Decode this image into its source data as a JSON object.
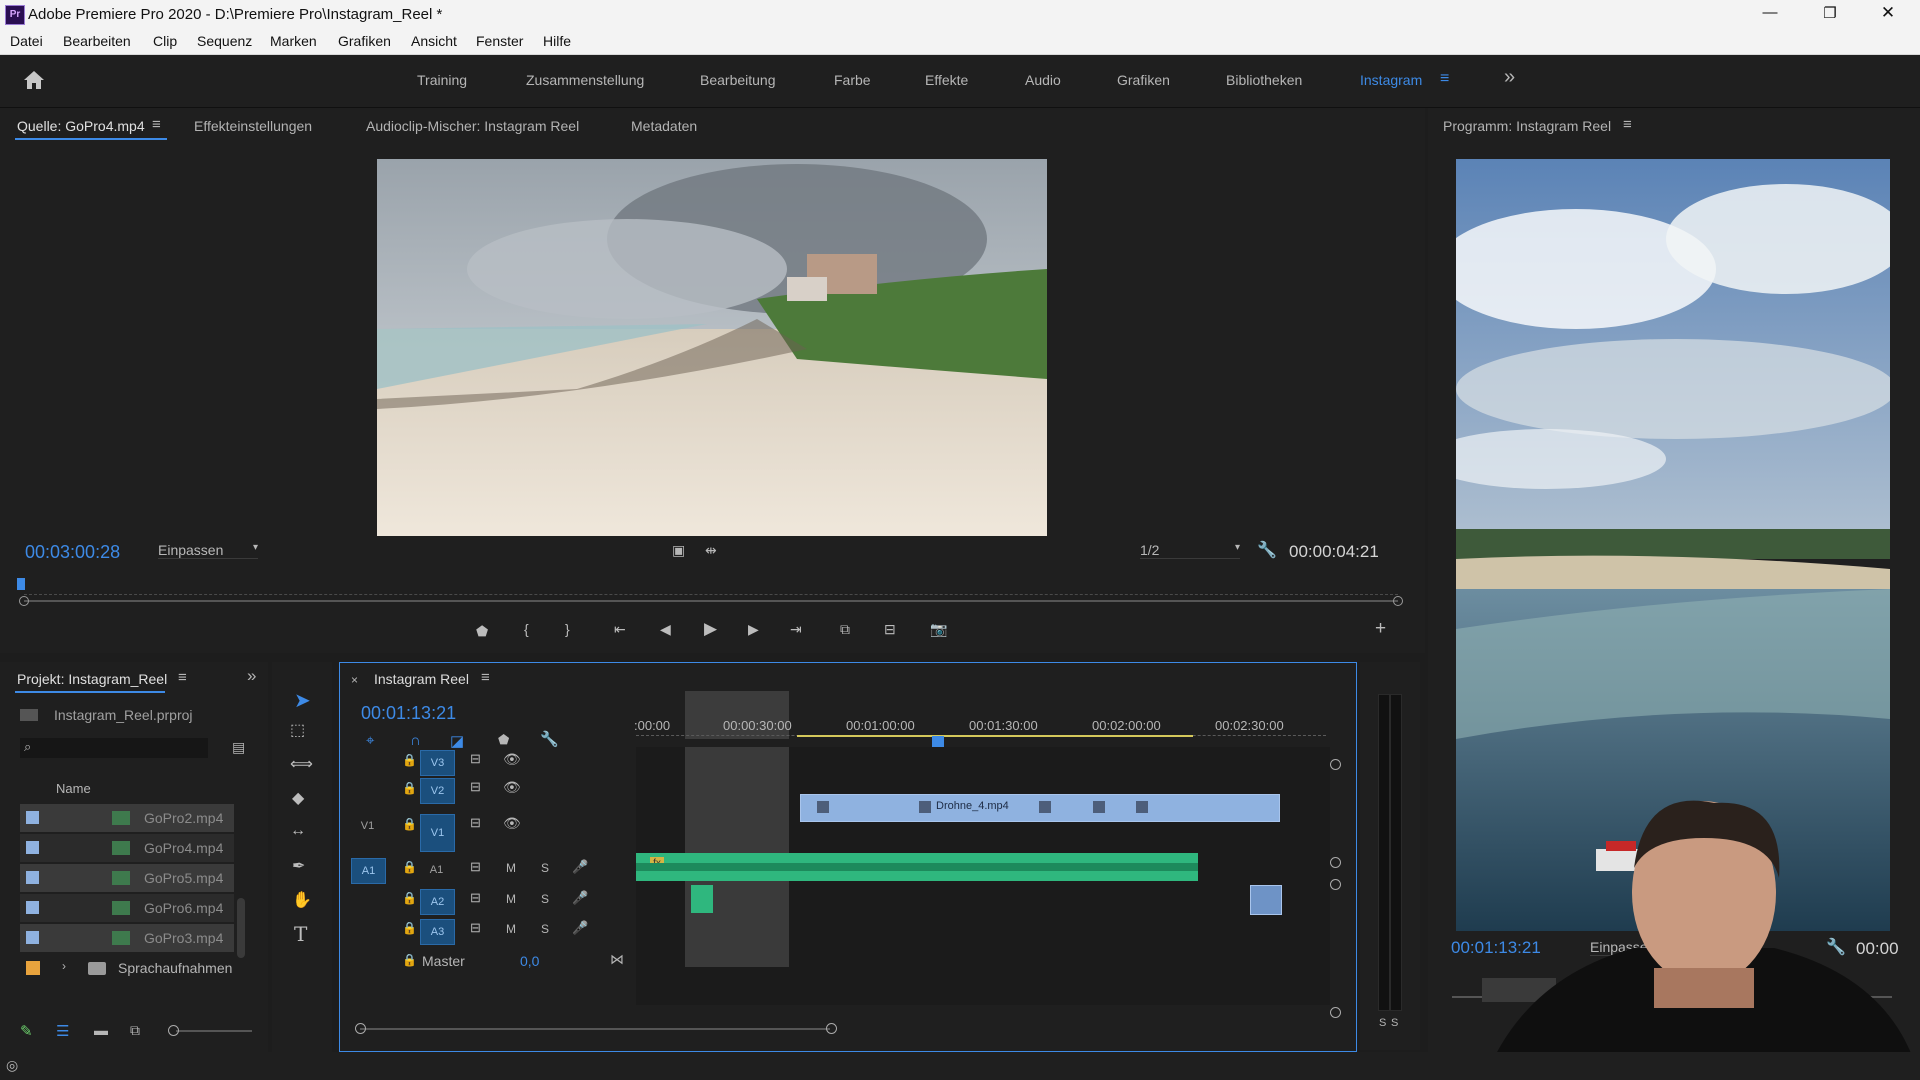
{
  "window": {
    "title": "Adobe Premiere Pro 2020 - D:\\Premiere Pro\\Instagram_Reel *",
    "app_badge": "Pr",
    "controls": [
      "—",
      "❐",
      "✕"
    ]
  },
  "menu": {
    "items": [
      "Datei",
      "Bearbeiten",
      "Clip",
      "Sequenz",
      "Marken",
      "Grafiken",
      "Ansicht",
      "Fenster",
      "Hilfe"
    ]
  },
  "workspaces": {
    "items": [
      "Training",
      "Zusammenstellung",
      "Bearbeitung",
      "Farbe",
      "Effekte",
      "Audio",
      "Grafiken",
      "Bibliotheken",
      "Instagram"
    ],
    "active": "Instagram",
    "overflow": "»"
  },
  "source_panel": {
    "tabs": [
      "Quelle: GoPro4.mp4",
      "Effekteinstellungen",
      "Audioclip-Mischer: Instagram Reel",
      "Metadaten"
    ],
    "timecode_in": "00:03:00:28",
    "zoom": "Einpassen",
    "resolution": "1/2",
    "duration": "00:00:04:21"
  },
  "program_panel": {
    "title": "Programm: Instagram Reel",
    "timecode": "00:01:13:21",
    "zoom": "Einpassen",
    "duration": "00:00"
  },
  "project_panel": {
    "title": "Projekt: Instagram_Reel",
    "file": "Instagram_Reel.prproj",
    "column_name": "Name",
    "search_placeholder": "",
    "items": [
      {
        "name": "GoPro2.mp4",
        "color": "#8fb2e0"
      },
      {
        "name": "GoPro4.mp4",
        "color": "#8fb2e0"
      },
      {
        "name": "GoPro5.mp4",
        "color": "#8fb2e0"
      },
      {
        "name": "GoPro6.mp4",
        "color": "#8fb2e0"
      },
      {
        "name": "GoPro3.mp4",
        "color": "#8fb2e0"
      },
      {
        "name": "Sprachaufnahmen",
        "color": "#e8a33d"
      }
    ]
  },
  "timeline": {
    "title": "Instagram Reel",
    "timecode": "00:01:13:21",
    "ruler": [
      ":00:00",
      "00:00:30:00",
      "00:01:00:00",
      "00:01:30:00",
      "00:02:00:00",
      "00:02:30:00"
    ],
    "video_tracks": [
      {
        "target": "V3",
        "label": "V3"
      },
      {
        "target": "V2",
        "label": "V2"
      },
      {
        "target": "V1",
        "label": "V1",
        "source": "V1"
      }
    ],
    "audio_tracks": [
      {
        "target": "A1",
        "label": "A1",
        "source": "A1"
      },
      {
        "target": "A2",
        "label": "A2"
      },
      {
        "target": "A3",
        "label": "A3"
      }
    ],
    "track_m": "M",
    "track_s": "S",
    "master_label": "Master",
    "master_value": "0,0",
    "clip_v2_label": "Drohne_4.mp4",
    "fx_badge": "fx"
  },
  "meter": {
    "labels": [
      "S",
      "S"
    ]
  },
  "colors": {
    "accent": "#3d8ae6",
    "video_clip": "#8fb2e0",
    "audio_clip": "#2fb77e",
    "label_orange": "#e8a33d"
  }
}
